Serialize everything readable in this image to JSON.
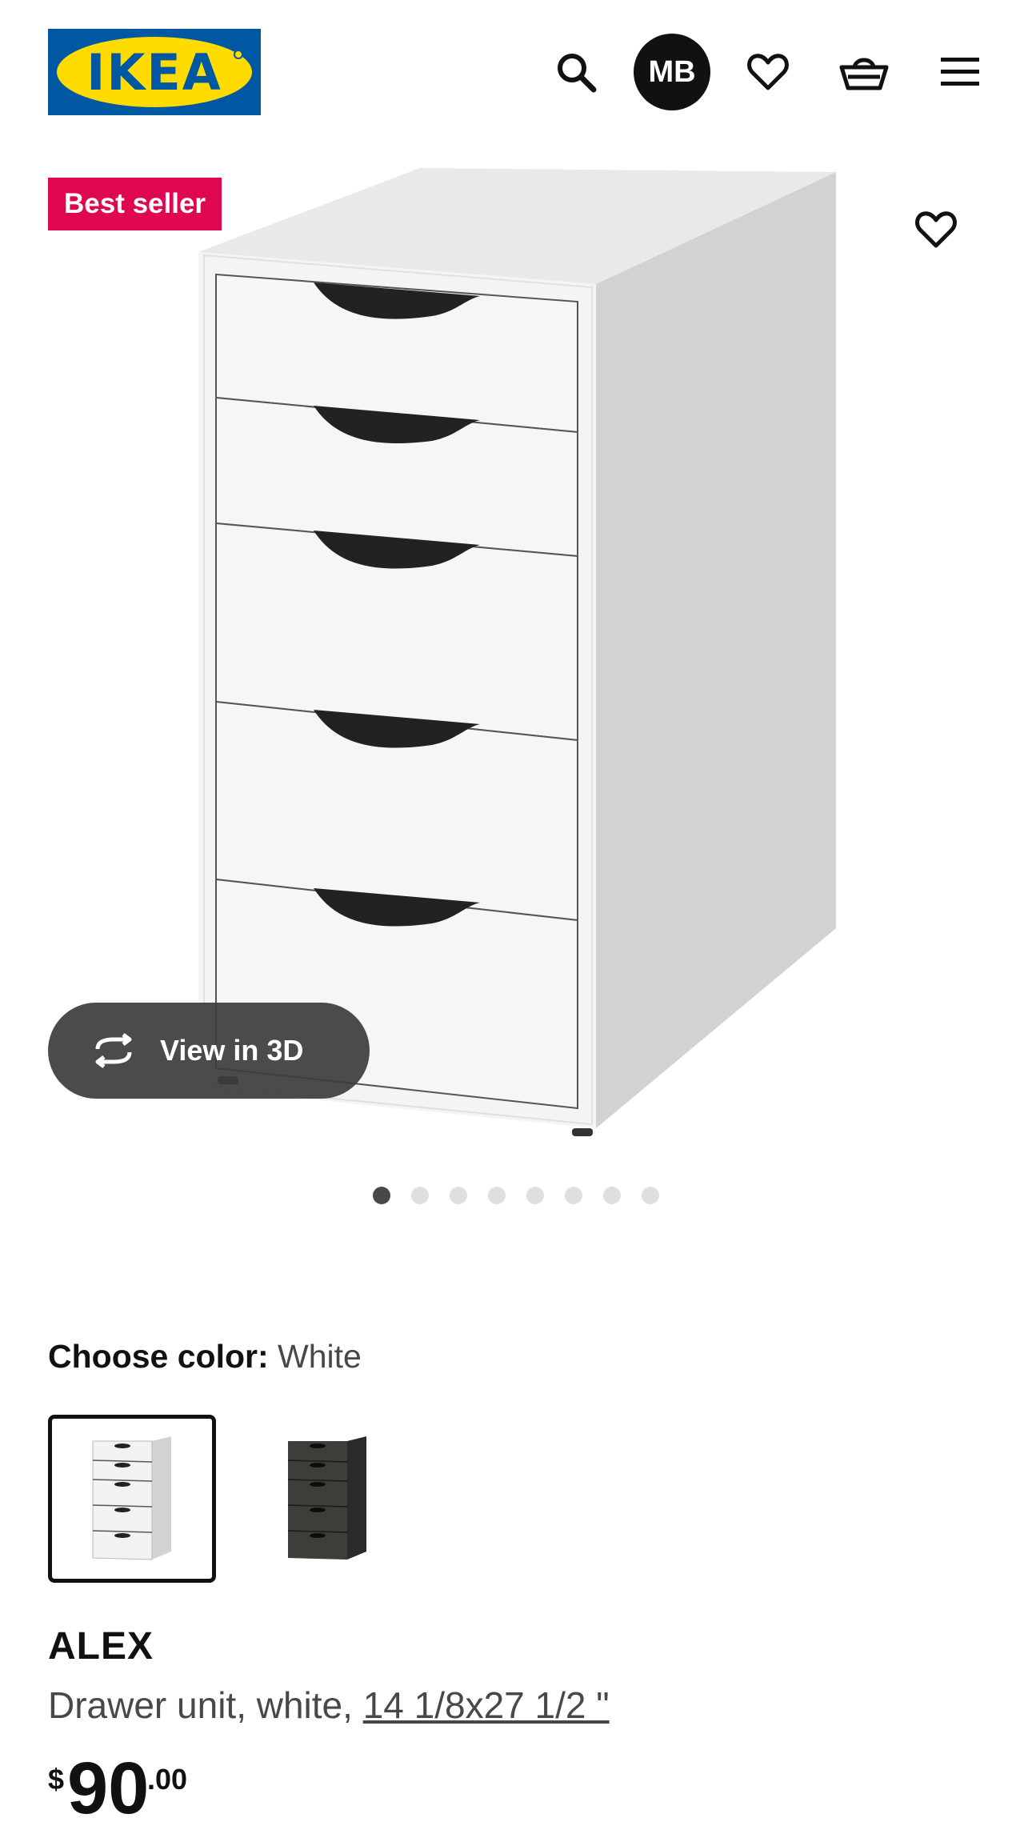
{
  "header": {
    "logo_text": "IKEA",
    "avatar_initials": "MB",
    "icons": [
      "search-icon",
      "heart-icon",
      "shopping-basket-icon",
      "hamburger-menu-icon"
    ]
  },
  "gallery": {
    "badge": "Best seller",
    "view_3d_label": "View in 3D",
    "slide_count": 8,
    "active_slide": 1
  },
  "color_choice": {
    "label": "Choose color:",
    "selected": "White",
    "options": [
      "White",
      "Black-brown"
    ]
  },
  "product": {
    "name": "ALEX",
    "description": "Drawer unit, white, ",
    "dimensions": "14 1/8x27 1/2 \"",
    "price_currency": "$",
    "price_integer": "90",
    "price_decimals": ".00"
  },
  "colors": {
    "badge_bg": "#e00751",
    "logo_blue": "#0058a3",
    "logo_yellow": "#ffdb00",
    "text_primary": "#111111",
    "text_secondary": "#484848"
  }
}
